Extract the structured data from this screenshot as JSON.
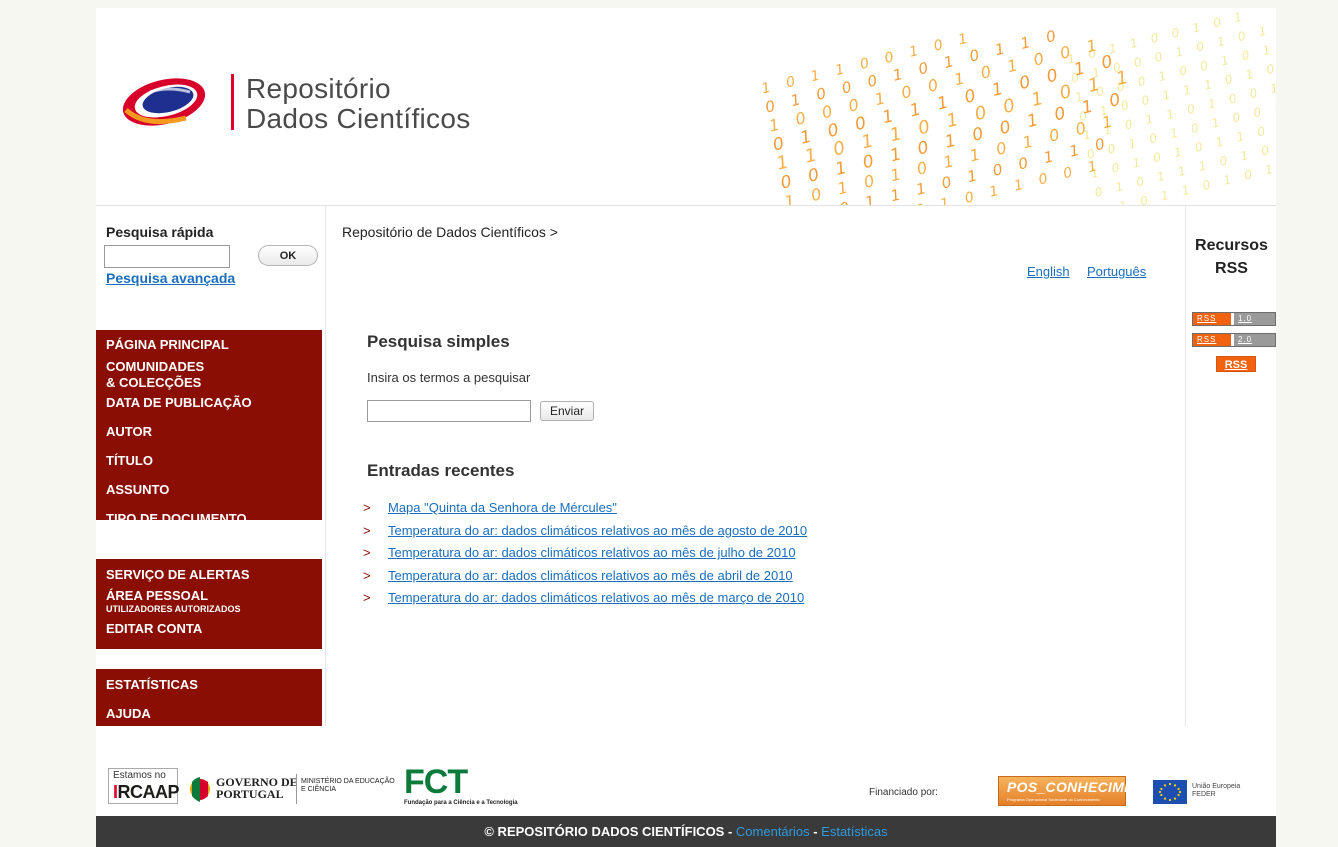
{
  "header": {
    "logo_line1": "Repositório",
    "logo_line2": "Dados Científicos",
    "binary_rows": [
      "1 0 1 1 0 0 1 0 1",
      "0 1 0 0 0 1 0 1 0 1 1 0",
      "1 0 0 0 1 0 0 1 0 1 0 0 1",
      "0 1 0 0 1 1 1 0 1 0 0 1 0",
      "1 1 0 1 1 0 1 0 0 1 0 1 1",
      "0 0 1 0 1 0 1 0 0 1 0 1 0",
      "1 0 1 0 1 0 1 1 0 1 0 0 1",
      "0 1 0 1 1 1 0 1 0 0 1 1 0",
      "0 1 0 1 1 0 1 0 1 1 0 0 1"
    ]
  },
  "colors": {
    "menu_bg": "#8a0e04",
    "link": "#1a6ebd",
    "footer_bg": "#3a3a3a"
  },
  "quick_search": {
    "title": "Pesquisa rápida",
    "input_value": "",
    "ok_label": "OK",
    "advanced_link": "Pesquisa avançada"
  },
  "menu_groups": [
    {
      "items": [
        {
          "label": "PÁGINA PRINCIPAL"
        },
        {
          "label": "COMUNIDADES\n& COLECÇÕES"
        },
        {
          "label": "DATA DE PUBLICAÇÃO"
        },
        {
          "label": "AUTOR"
        },
        {
          "label": "TÍTULO"
        },
        {
          "label": "ASSUNTO"
        },
        {
          "label": "TIPO DE DOCUMENTO"
        }
      ]
    },
    {
      "items": [
        {
          "label": "SERVIÇO DE ALERTAS"
        },
        {
          "label": "ÁREA PESSOAL",
          "sub": "UTILIZADORES AUTORIZADOS"
        },
        {
          "label": "EDITAR CONTA"
        }
      ]
    },
    {
      "items": [
        {
          "label": "ESTATÍSTICAS"
        },
        {
          "label": "AJUDA"
        }
      ]
    }
  ],
  "breadcrumb": "Repositório de Dados Científicos >",
  "languages": {
    "english": "English",
    "portugues": "Português"
  },
  "simple_search": {
    "title": "Pesquisa simples",
    "label": "Insira os termos a pesquisar",
    "input_value": "",
    "submit_label": "Enviar"
  },
  "recent": {
    "title": "Entradas recentes",
    "bullet": ">",
    "entries": [
      "Mapa \"Quinta da Senhora de Mércules\"",
      "Temperatura do ar: dados climáticos relativos ao mês de agosto de 2010",
      "Temperatura do ar: dados climáticos relativos ao mês de julho de 2010",
      "Temperatura do ar: dados climáticos relativos ao mês de abril de 2010",
      "Temperatura do ar: dados climáticos relativos ao mês de março de 2010"
    ]
  },
  "rss": {
    "title_line1": "Recursos",
    "title_line2": "RSS",
    "badge_left": "RSS",
    "badge1_version": "1.0",
    "badge2_version": "2.0",
    "plain": "RSS"
  },
  "footer_logos": {
    "acaap_line1": "Estamos no",
    "acaap_line2_a": "I",
    "acaap_line2_b": "RCAAP",
    "gov_line1": "GOVERNO DE",
    "gov_line2": "PORTUGAL",
    "ministry_line1": "MINISTÉRIO DA EDUCAÇÃO",
    "ministry_line2": "E CIÊNCIA",
    "fct": "FCT",
    "fct_sub": "Fundação para a Ciência e a Tecnologia",
    "financed_label": "Financiado por:",
    "pos_line1": "POS_CONHECIMENTO",
    "pos_line2": "Programa Operacional Sociedade do Conhecimento",
    "eu_line1": "União Europeia",
    "eu_line2": "FEDER"
  },
  "bottom_bar": {
    "copyright": "© REPOSITÓRIO DADOS CIENTÍFICOS - ",
    "comments": "Comentários",
    "separator": " - ",
    "stats": "Estatísticas"
  }
}
